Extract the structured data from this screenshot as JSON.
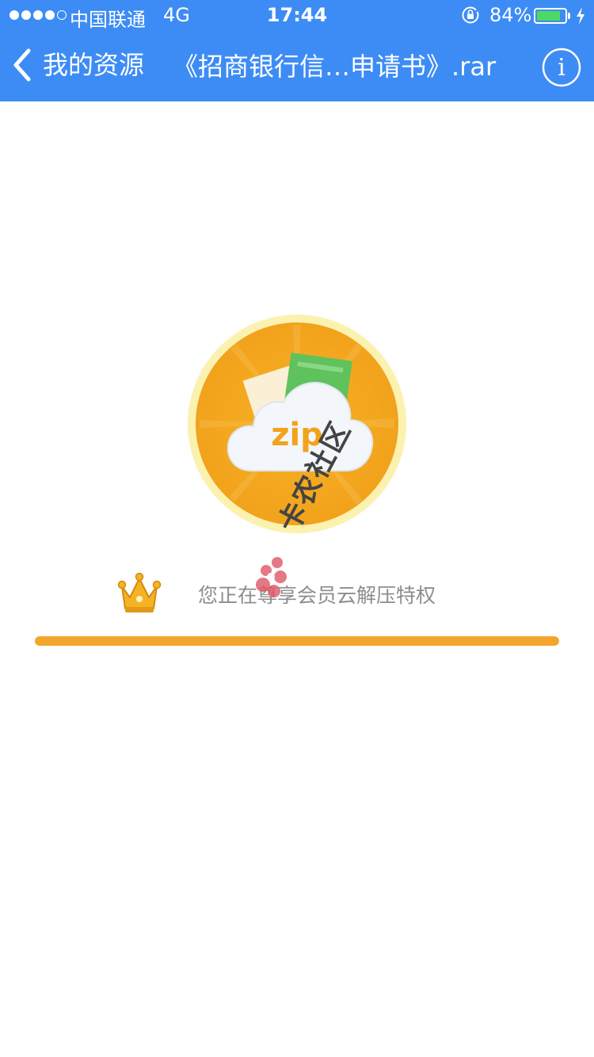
{
  "status_bar": {
    "carrier": "中国联通",
    "network": "4G",
    "time": "17:44",
    "battery_percent": "84%",
    "battery_level": 0.84,
    "signal_bars": 4,
    "signal_total": 5
  },
  "nav": {
    "back_label": "我的资源",
    "title": "《招商银行信…申请书》.rar",
    "info_label": "i"
  },
  "main": {
    "logo_text": "zip",
    "vip_text": "您正在尊享会员云解压特权",
    "progress": 1.0
  },
  "watermark": {
    "text": "卡农社区"
  },
  "colors": {
    "nav_bg": "#3d8cf5",
    "accent": "#f4a62b",
    "battery": "#4cd964"
  }
}
